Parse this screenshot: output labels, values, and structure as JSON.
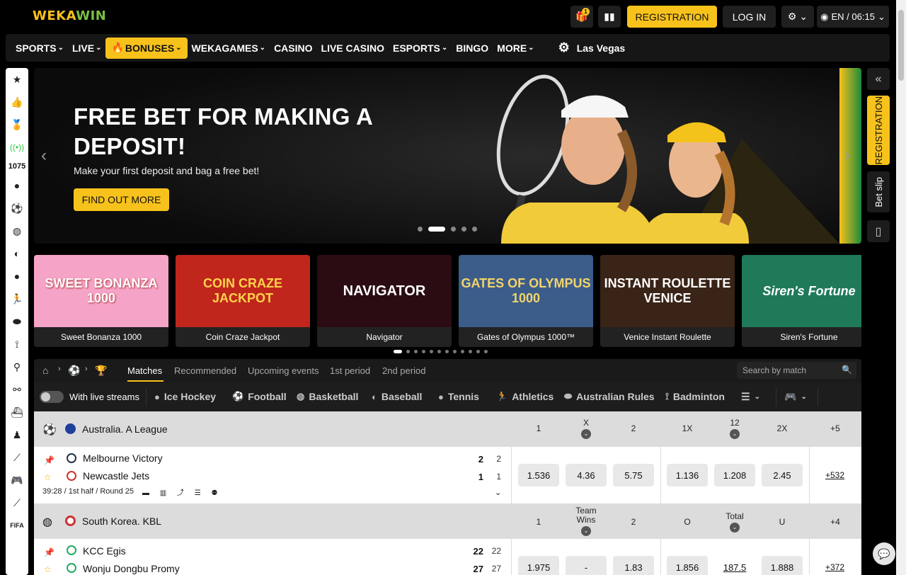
{
  "header": {
    "logo_part1": "WEKA",
    "logo_part2": "WIN",
    "gift_badge": "1",
    "registration": "REGISTRATION",
    "login": "LOG IN",
    "lang_time": "EN / 06:15"
  },
  "nav": {
    "items": [
      "SPORTS",
      "LIVE",
      "BONUSES",
      "WEKAGAMES",
      "CASINO",
      "LIVE CASINO",
      "ESPORTS",
      "BINGO",
      "MORE"
    ],
    "featured": "Las Vegas"
  },
  "left_rail": {
    "count": "1075"
  },
  "right_rail": {
    "registration": "REGISTRATION",
    "bet_slip": "Bet slip",
    "collapse": "«"
  },
  "banner": {
    "title": "FREE BET FOR MAKING A DEPOSIT!",
    "subtitle": "Make your first deposit and bag a free bet!",
    "cta": "FIND OUT MORE",
    "slide_index": 2,
    "slide_count": 6
  },
  "games": [
    {
      "title": "Sweet Bonanza 1000",
      "art": "SWEET BONANZA 1000",
      "color": "#f5a3c7"
    },
    {
      "title": "Coin Craze Jackpot",
      "art": "COIN CRAZE JACKPOT",
      "color": "#c0261c"
    },
    {
      "title": "Navigator",
      "art": "NAVIGATOR",
      "color": "#2a0c12"
    },
    {
      "title": "Gates of Olympus 1000™",
      "art": "GATES OF OLYMPUS 1000",
      "color": "#3c5d8a"
    },
    {
      "title": "Venice Instant Roulette",
      "art": "INSTANT ROULETTE VENICE",
      "color": "#3a2417"
    },
    {
      "title": "Siren's Fortune",
      "art": "Siren's Fortune",
      "color": "#1f7a5a"
    }
  ],
  "panel": {
    "tabs": [
      "Matches",
      "Recommended",
      "Upcoming events",
      "1st period",
      "2nd period"
    ],
    "search_placeholder": "Search by match",
    "live_streams_label": "With live streams",
    "sports": [
      "Ice Hockey",
      "Football",
      "Basketball",
      "Baseball",
      "Tennis",
      "Athletics",
      "Australian Rules",
      "Badminton"
    ]
  },
  "leagues": [
    {
      "name": "Australia. A League",
      "cols": [
        "1",
        "X",
        "2",
        "1X",
        "12",
        "2X",
        "+5"
      ],
      "match": {
        "home": "Melbourne Victory",
        "away": "Newcastle Jets",
        "home_score": "2",
        "home_score2": "2",
        "away_score": "1",
        "away_score2": "1",
        "info": "39:28 / 1st half / Round 25",
        "odds": [
          "1.536",
          "4.36",
          "5.75",
          "1.136",
          "1.208",
          "2.45"
        ],
        "more": "+532"
      }
    },
    {
      "name": "South Korea. KBL",
      "cols": [
        "1",
        "Team Wins",
        "2",
        "O",
        "Total",
        "U",
        "+4"
      ],
      "match": {
        "home": "KCC Egis",
        "away": "Wonju Dongbu Promy",
        "home_score": "22",
        "home_score2": "22",
        "away_score": "27",
        "away_score2": "27",
        "odds": [
          "1.975",
          "-",
          "1.83",
          "1.856",
          "187.5",
          "1.888"
        ],
        "more": "+372"
      }
    }
  ]
}
